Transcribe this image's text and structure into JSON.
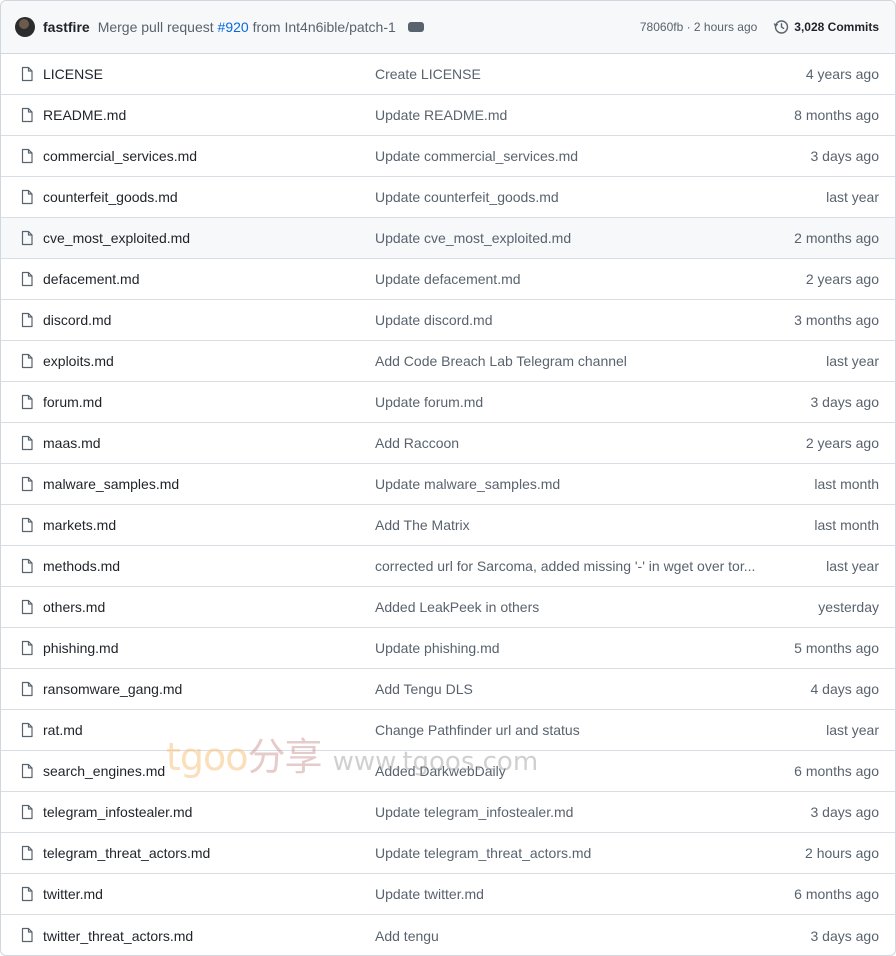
{
  "commit": {
    "author": "fastfire",
    "message_prefix": "Merge pull request",
    "pr_number": "#920",
    "message_suffix": "from Int4n6ible/patch-1",
    "sha_time": "78060fb · 2 hours ago",
    "commits_label": "3,028 Commits"
  },
  "files": [
    {
      "name": "LICENSE",
      "message": "Create LICENSE",
      "date": "4 years ago"
    },
    {
      "name": "README.md",
      "message": "Update README.md",
      "date": "8 months ago"
    },
    {
      "name": "commercial_services.md",
      "message": "Update commercial_services.md",
      "date": "3 days ago"
    },
    {
      "name": "counterfeit_goods.md",
      "message": "Update counterfeit_goods.md",
      "date": "last year"
    },
    {
      "name": "cve_most_exploited.md",
      "message": "Update cve_most_exploited.md",
      "date": "2 months ago"
    },
    {
      "name": "defacement.md",
      "message": "Update defacement.md",
      "date": "2 years ago"
    },
    {
      "name": "discord.md",
      "message": "Update discord.md",
      "date": "3 months ago"
    },
    {
      "name": "exploits.md",
      "message": "Add Code Breach Lab Telegram channel",
      "date": "last year"
    },
    {
      "name": "forum.md",
      "message": "Update forum.md",
      "date": "3 days ago"
    },
    {
      "name": "maas.md",
      "message": "Add Raccoon",
      "date": "2 years ago"
    },
    {
      "name": "malware_samples.md",
      "message": "Update malware_samples.md",
      "date": "last month"
    },
    {
      "name": "markets.md",
      "message": "Add The Matrix",
      "date": "last month"
    },
    {
      "name": "methods.md",
      "message": "corrected url for Sarcoma, added missing '-' in wget over tor...",
      "date": "last year"
    },
    {
      "name": "others.md",
      "message": "Added LeakPeek in others",
      "date": "yesterday"
    },
    {
      "name": "phishing.md",
      "message": "Update phishing.md",
      "date": "5 months ago"
    },
    {
      "name": "ransomware_gang.md",
      "message": "Add Tengu DLS",
      "date": "4 days ago"
    },
    {
      "name": "rat.md",
      "message": "Change Pathfinder url and status",
      "date": "last year"
    },
    {
      "name": "search_engines.md",
      "message": "Added DarkwebDaily",
      "date": "6 months ago"
    },
    {
      "name": "telegram_infostealer.md",
      "message": "Update telegram_infostealer.md",
      "date": "3 days ago"
    },
    {
      "name": "telegram_threat_actors.md",
      "message": "Update telegram_threat_actors.md",
      "date": "2 hours ago"
    },
    {
      "name": "twitter.md",
      "message": "Update twitter.md",
      "date": "6 months ago"
    },
    {
      "name": "twitter_threat_actors.md",
      "message": "Add tengu",
      "date": "3 days ago"
    }
  ],
  "hover_row": 4,
  "watermark": {
    "brand": "tgoo",
    "cn": "分享",
    "url": "www.tgoos.com"
  },
  "colors": {
    "link": "#0969da",
    "muted": "#59636e",
    "text": "#1f2328",
    "border": "#d0d7de"
  }
}
